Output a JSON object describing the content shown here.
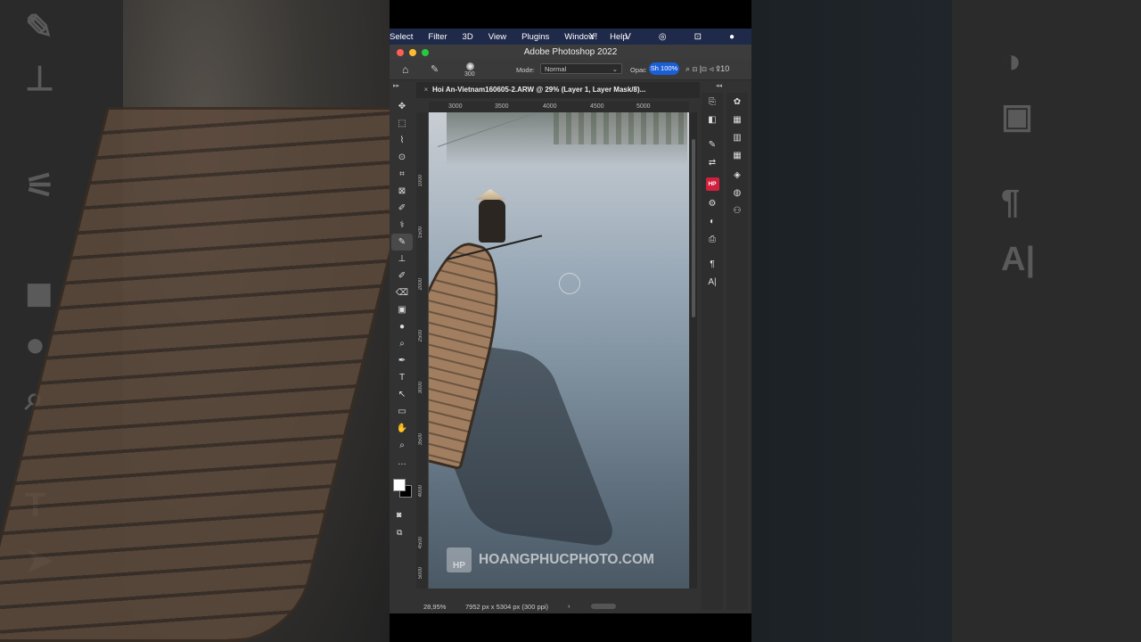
{
  "background": {
    "left_glyphs": [
      "✎",
      "⊥",
      "⚟",
      "◼",
      "●",
      "⌕",
      "T",
      "➤"
    ],
    "right_glyphs": [
      "◑",
      "▣",
      "¶",
      "A|"
    ]
  },
  "menubar": {
    "items": [
      "Select",
      "Filter",
      "3D",
      "View",
      "Plugins",
      "Window",
      "Help"
    ],
    "icons": [
      "Y!",
      "V",
      "◎",
      "⊡",
      "●"
    ]
  },
  "window": {
    "title": "Adobe Photoshop 2022",
    "traffic_colors": [
      "#ff5f57",
      "#febc2e",
      "#28c840"
    ]
  },
  "options": {
    "home_icon": "⌂",
    "brush_icon": "✎",
    "brush_size": "300",
    "mode_label": "Mode:",
    "mode_value": "Normal",
    "opacity_label": "Opac",
    "zoom_pill": "Sh 100%",
    "right_icons": "⌕  ⊡ |⊡ ⊲ ⇪10"
  },
  "document": {
    "tab_title": "Hoi An-Vietnam160605-2.ARW @ 29% (Layer 1, Layer Mask/8)...",
    "ruler_top": [
      "3000",
      "3500",
      "4000",
      "4500",
      "5000"
    ],
    "ruler_left": [
      "1000",
      "1500",
      "2000",
      "2500",
      "3000",
      "3500",
      "4000",
      "4500",
      "5000"
    ],
    "watermark_logo": "HP",
    "watermark_text": "HOANGPHUCPHOTO.COM"
  },
  "tools": [
    "✥",
    "⬚",
    "⌇",
    "⊙",
    "⌗",
    "⊠",
    "✐",
    "⚕",
    "✎",
    "⊥",
    "✐",
    "⌫",
    "▣",
    "●",
    "⌕",
    "✒",
    "T",
    "↖",
    "▭",
    "✋",
    "⌕",
    "…"
  ],
  "status": {
    "zoom": "28,95%",
    "dimensions": "7952 px x 5304 px (300 ppi)",
    "arrow": "›"
  },
  "dock1": [
    "⎘",
    "◧",
    "✎",
    "⇄",
    "HP",
    "⚙",
    "◐",
    "⎙",
    "¶",
    "A|"
  ],
  "dock2": [
    "✿",
    "▦",
    "▥",
    "▦",
    "◈",
    "◍",
    "⚇"
  ]
}
